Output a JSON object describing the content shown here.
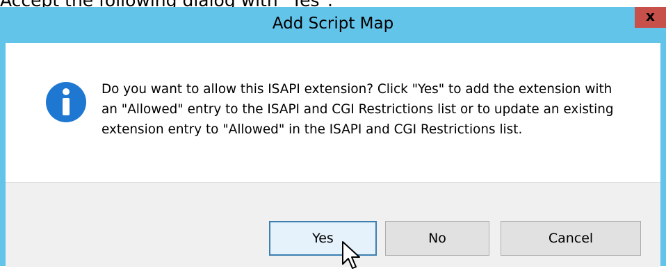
{
  "caption": "Accept the following dialog with \"Yes\".",
  "dialog": {
    "title": "Add Script Map",
    "close_label": "x",
    "message": "Do you want to allow this ISAPI extension? Click \"Yes\" to add the extension with an \"Allowed\" entry to the ISAPI and CGI Restrictions list or to update an existing extension entry to \"Allowed\" in the ISAPI and CGI Restrictions list.",
    "icon": "info-icon",
    "buttons": {
      "yes": "Yes",
      "no": "No",
      "cancel": "Cancel"
    }
  },
  "colors": {
    "titlebar": "#63c4ea",
    "close": "#c7504b",
    "info_icon": "#1e78d2",
    "footer": "#f0f0f0"
  }
}
